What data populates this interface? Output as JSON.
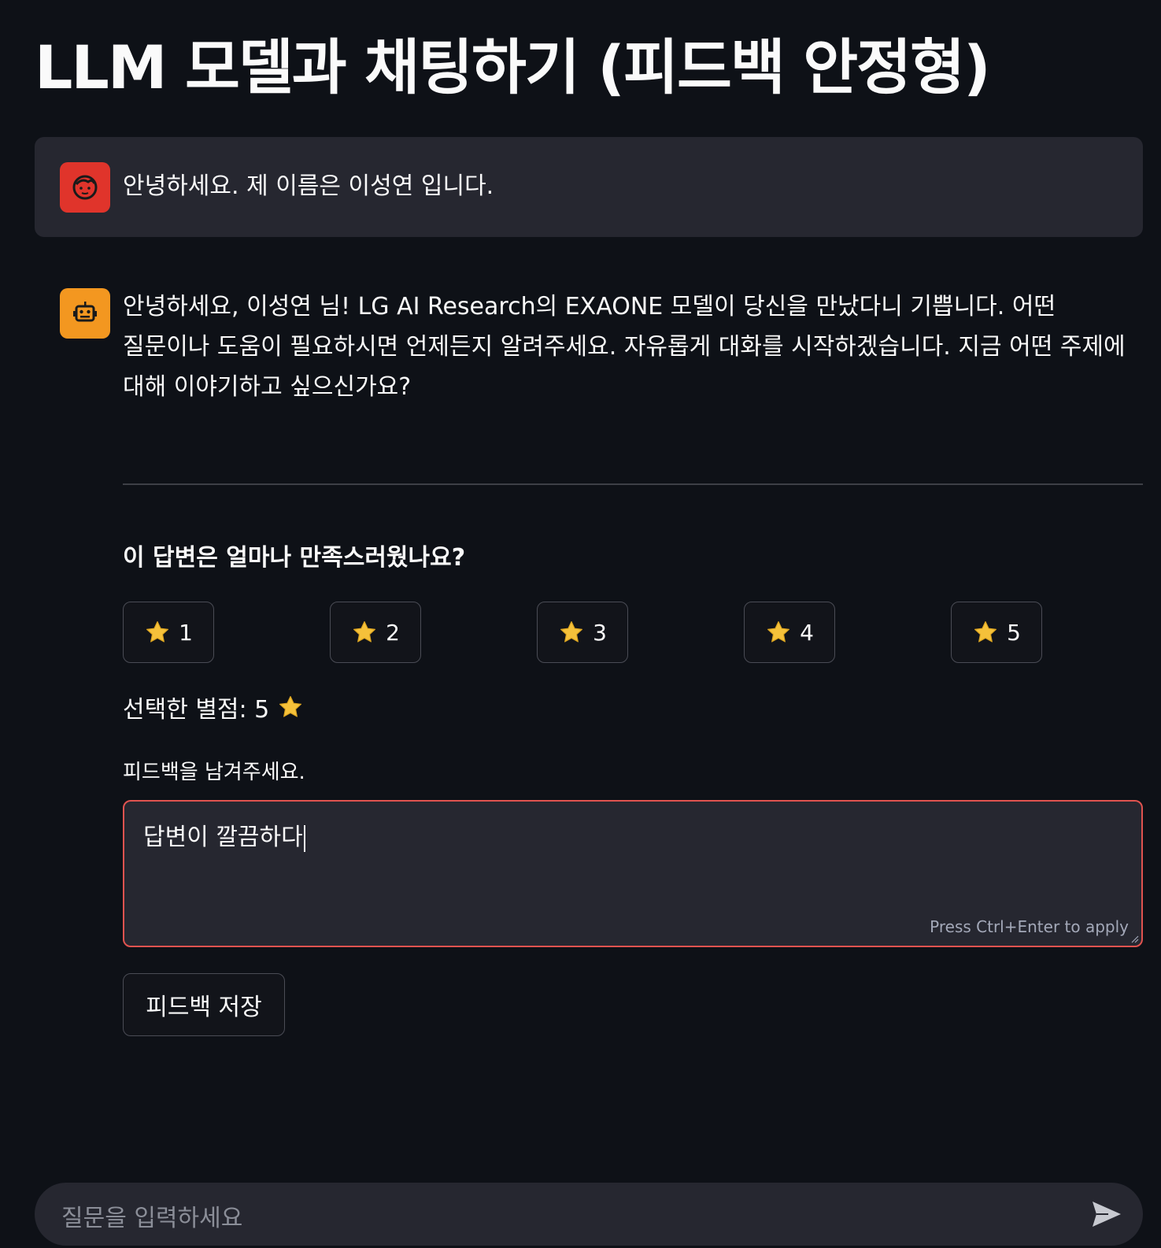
{
  "page": {
    "title": "LLM 모델과 채팅하기 (피드백 안정형)"
  },
  "chat": {
    "user_message": "안녕하세요. 제 이름은 이성연 입니다.",
    "user_avatar_icon": "face-icon",
    "assistant_message": "안녕하세요, 이성연 님! LG AI Research의 EXAONE 모델이 당신을 만났다니 기쁩니다. 어떤 질문이나 도움이 필요하시면 언제든지 알려주세요. 자유롭게 대화를 시작하겠습니다. 지금 어떤 주제에 대해 이야기하고 싶으신가요?",
    "assistant_avatar_icon": "robot-icon"
  },
  "rating": {
    "question": "이 답변은 얼마나 만족스러웠나요?",
    "buttons": [
      "1",
      "2",
      "3",
      "4",
      "5"
    ],
    "selected_text": "선택한 별점: 5",
    "selected_value": 5,
    "star_color": "#f5c13a"
  },
  "feedback": {
    "label": "피드백을 남겨주세요.",
    "value": "답변이 깔끔하다",
    "hint": "Press Ctrl+Enter to apply",
    "save_label": "피드백 저장",
    "border_color": "#e0534f"
  },
  "chat_input": {
    "placeholder": "질문을 입력하세요"
  }
}
